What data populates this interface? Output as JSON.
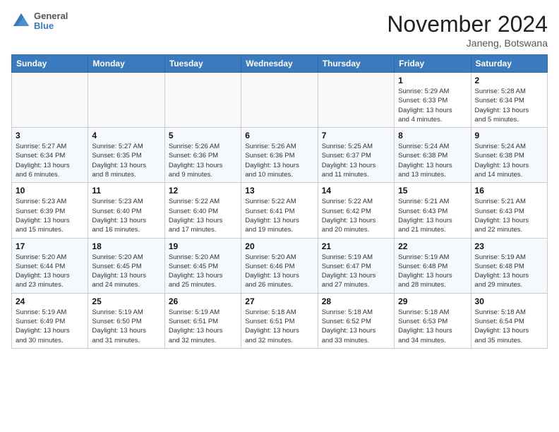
{
  "header": {
    "logo": {
      "general": "General",
      "blue": "Blue"
    },
    "title": "November 2024",
    "location": "Janeng, Botswana"
  },
  "columns": [
    "Sunday",
    "Monday",
    "Tuesday",
    "Wednesday",
    "Thursday",
    "Friday",
    "Saturday"
  ],
  "weeks": [
    [
      {
        "day": "",
        "info": ""
      },
      {
        "day": "",
        "info": ""
      },
      {
        "day": "",
        "info": ""
      },
      {
        "day": "",
        "info": ""
      },
      {
        "day": "",
        "info": ""
      },
      {
        "day": "1",
        "info": "Sunrise: 5:29 AM\nSunset: 6:33 PM\nDaylight: 13 hours\nand 4 minutes."
      },
      {
        "day": "2",
        "info": "Sunrise: 5:28 AM\nSunset: 6:34 PM\nDaylight: 13 hours\nand 5 minutes."
      }
    ],
    [
      {
        "day": "3",
        "info": "Sunrise: 5:27 AM\nSunset: 6:34 PM\nDaylight: 13 hours\nand 6 minutes."
      },
      {
        "day": "4",
        "info": "Sunrise: 5:27 AM\nSunset: 6:35 PM\nDaylight: 13 hours\nand 8 minutes."
      },
      {
        "day": "5",
        "info": "Sunrise: 5:26 AM\nSunset: 6:36 PM\nDaylight: 13 hours\nand 9 minutes."
      },
      {
        "day": "6",
        "info": "Sunrise: 5:26 AM\nSunset: 6:36 PM\nDaylight: 13 hours\nand 10 minutes."
      },
      {
        "day": "7",
        "info": "Sunrise: 5:25 AM\nSunset: 6:37 PM\nDaylight: 13 hours\nand 11 minutes."
      },
      {
        "day": "8",
        "info": "Sunrise: 5:24 AM\nSunset: 6:38 PM\nDaylight: 13 hours\nand 13 minutes."
      },
      {
        "day": "9",
        "info": "Sunrise: 5:24 AM\nSunset: 6:38 PM\nDaylight: 13 hours\nand 14 minutes."
      }
    ],
    [
      {
        "day": "10",
        "info": "Sunrise: 5:23 AM\nSunset: 6:39 PM\nDaylight: 13 hours\nand 15 minutes."
      },
      {
        "day": "11",
        "info": "Sunrise: 5:23 AM\nSunset: 6:40 PM\nDaylight: 13 hours\nand 16 minutes."
      },
      {
        "day": "12",
        "info": "Sunrise: 5:22 AM\nSunset: 6:40 PM\nDaylight: 13 hours\nand 17 minutes."
      },
      {
        "day": "13",
        "info": "Sunrise: 5:22 AM\nSunset: 6:41 PM\nDaylight: 13 hours\nand 19 minutes."
      },
      {
        "day": "14",
        "info": "Sunrise: 5:22 AM\nSunset: 6:42 PM\nDaylight: 13 hours\nand 20 minutes."
      },
      {
        "day": "15",
        "info": "Sunrise: 5:21 AM\nSunset: 6:43 PM\nDaylight: 13 hours\nand 21 minutes."
      },
      {
        "day": "16",
        "info": "Sunrise: 5:21 AM\nSunset: 6:43 PM\nDaylight: 13 hours\nand 22 minutes."
      }
    ],
    [
      {
        "day": "17",
        "info": "Sunrise: 5:20 AM\nSunset: 6:44 PM\nDaylight: 13 hours\nand 23 minutes."
      },
      {
        "day": "18",
        "info": "Sunrise: 5:20 AM\nSunset: 6:45 PM\nDaylight: 13 hours\nand 24 minutes."
      },
      {
        "day": "19",
        "info": "Sunrise: 5:20 AM\nSunset: 6:45 PM\nDaylight: 13 hours\nand 25 minutes."
      },
      {
        "day": "20",
        "info": "Sunrise: 5:20 AM\nSunset: 6:46 PM\nDaylight: 13 hours\nand 26 minutes."
      },
      {
        "day": "21",
        "info": "Sunrise: 5:19 AM\nSunset: 6:47 PM\nDaylight: 13 hours\nand 27 minutes."
      },
      {
        "day": "22",
        "info": "Sunrise: 5:19 AM\nSunset: 6:48 PM\nDaylight: 13 hours\nand 28 minutes."
      },
      {
        "day": "23",
        "info": "Sunrise: 5:19 AM\nSunset: 6:48 PM\nDaylight: 13 hours\nand 29 minutes."
      }
    ],
    [
      {
        "day": "24",
        "info": "Sunrise: 5:19 AM\nSunset: 6:49 PM\nDaylight: 13 hours\nand 30 minutes."
      },
      {
        "day": "25",
        "info": "Sunrise: 5:19 AM\nSunset: 6:50 PM\nDaylight: 13 hours\nand 31 minutes."
      },
      {
        "day": "26",
        "info": "Sunrise: 5:19 AM\nSunset: 6:51 PM\nDaylight: 13 hours\nand 32 minutes."
      },
      {
        "day": "27",
        "info": "Sunrise: 5:18 AM\nSunset: 6:51 PM\nDaylight: 13 hours\nand 32 minutes."
      },
      {
        "day": "28",
        "info": "Sunrise: 5:18 AM\nSunset: 6:52 PM\nDaylight: 13 hours\nand 33 minutes."
      },
      {
        "day": "29",
        "info": "Sunrise: 5:18 AM\nSunset: 6:53 PM\nDaylight: 13 hours\nand 34 minutes."
      },
      {
        "day": "30",
        "info": "Sunrise: 5:18 AM\nSunset: 6:54 PM\nDaylight: 13 hours\nand 35 minutes."
      }
    ]
  ]
}
